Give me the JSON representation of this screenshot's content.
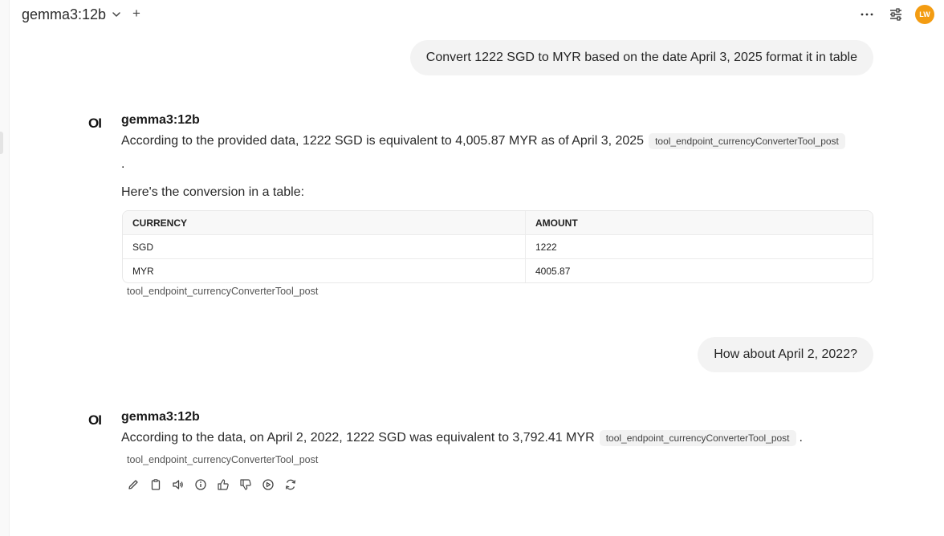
{
  "header": {
    "model_name": "gemma3:12b",
    "new_chat_label": "+",
    "more_label": "···",
    "avatar_initials": "LW",
    "avatar_color": "#f39c12"
  },
  "conversation": [
    {
      "role": "user",
      "text": "Convert 1222 SGD to MYR based on the date April 3, 2025 format it in table"
    },
    {
      "role": "assistant",
      "model": "gemma3:12b",
      "logo": "OI",
      "text": "According to the provided data, 1222 SGD is equivalent to 4,005.87 MYR as of April 3, 2025",
      "citation": "tool_endpoint_currencyConverterTool_post",
      "trailing": ".",
      "table_intro": "Here's the conversion in a table:",
      "table": {
        "headers": [
          "CURRENCY",
          "AMOUNT"
        ],
        "rows": [
          [
            "SGD",
            "1222"
          ],
          [
            "MYR",
            "4005.87"
          ]
        ]
      },
      "source": "tool_endpoint_currencyConverterTool_post"
    },
    {
      "role": "user",
      "text": "How about April 2, 2022?"
    },
    {
      "role": "assistant",
      "model": "gemma3:12b",
      "logo": "OI",
      "text": "According to the data, on April 2, 2022, 1222 SGD was equivalent to 3,792.41 MYR",
      "citation": "tool_endpoint_currencyConverterTool_post",
      "trailing": ".",
      "source": "tool_endpoint_currencyConverterTool_post"
    }
  ],
  "actions": [
    "edit-icon",
    "copy-icon",
    "read-aloud-icon",
    "info-icon",
    "thumbs-up-icon",
    "thumbs-down-icon",
    "continue-icon",
    "regenerate-icon"
  ]
}
